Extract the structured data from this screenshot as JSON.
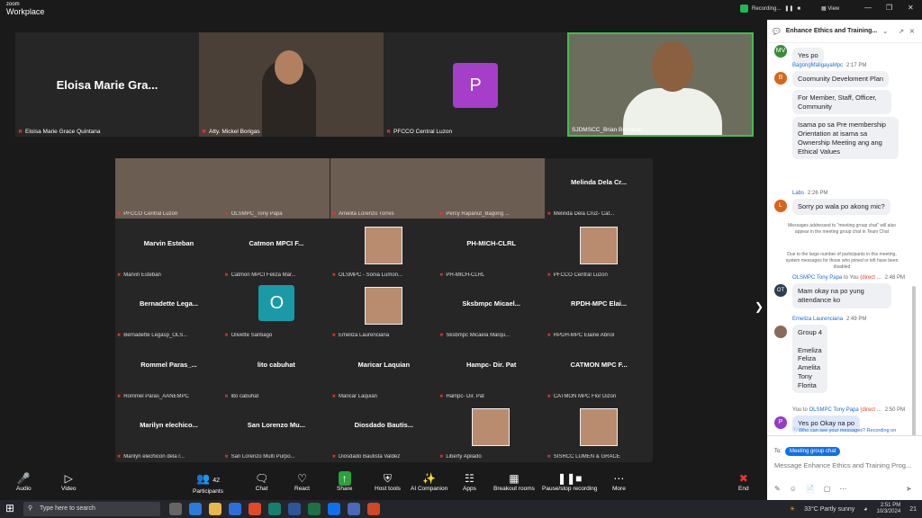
{
  "app": {
    "brand_small": "zoom",
    "brand": "Workplace",
    "recording": "Recording...",
    "view": "View",
    "win_min": "—",
    "win_max": "❐",
    "win_close": "✕"
  },
  "top_strip": [
    {
      "name": "Eloisa Marie Gra...",
      "caption": "Eloisa Marie Grace Quintana"
    },
    {
      "caption": "Atty. Mickel Borigas"
    },
    {
      "avatar": "P",
      "caption": "PFCCO Central Luzon",
      "color": "#a53ec8"
    },
    {
      "caption": "SJDMSCC_Brian Bernardo"
    }
  ],
  "gallery": [
    {
      "caption": "PFCCO Central Luzon",
      "video": true
    },
    {
      "caption": "OLSMPC_Tony Papa",
      "video": true
    },
    {
      "caption": "Amelita Lorenzo Torres",
      "video": true
    },
    {
      "caption": "Percy Rapanut_Bagong ...",
      "video": true
    },
    {
      "name": "Melinda Dela Cr...",
      "caption": "Melinda Dela Cruz- Cat..."
    },
    {
      "name": "Marvin Esteban",
      "caption": "Marvin Esteban"
    },
    {
      "name": "Catmon MPCI F...",
      "caption": "Catmon MPCI Feliza Mar..."
    },
    {
      "caption": "OLSMPC - Sonia Lumon...",
      "video": true
    },
    {
      "name": "PH-MICH-CLRL",
      "caption": "PH-MICH-CLRL"
    },
    {
      "caption": "PFCCO Central Luzon",
      "video": true
    },
    {
      "name": "Bernadette Lega...",
      "caption": "Bernadette Legasp_OLS..."
    },
    {
      "avatar": "O",
      "caption": "Olivette Santiago"
    },
    {
      "caption": "Emeliza Laurenciana",
      "video": true
    },
    {
      "name": "Sksbmpc Micael...",
      "caption": "Sksbmpc Micaela Marqu..."
    },
    {
      "name": "RPDH-MPC Elai...",
      "caption": "RPDH-MPC Elaine Abriol"
    },
    {
      "name": "Rommel Paras_...",
      "caption": "Rommel Paras_AANEMPC"
    },
    {
      "name": "lito cabuhat",
      "caption": "lito cabuhat"
    },
    {
      "name": "Maricar Laquian",
      "caption": "Maricar Laquian"
    },
    {
      "name": "Hampc- Dir. Pat",
      "caption": "Hampc- Dir. Pat"
    },
    {
      "name": "CATMON MPC F...",
      "caption": "CATMON MPC Flor Dizon"
    },
    {
      "name": "Marilyn elechico...",
      "caption": "Marilyn elechicon dela r..."
    },
    {
      "name": "San Lorenzo Mu...",
      "caption": "San Lorenzo Multi Purpo..."
    },
    {
      "name": "Diosdado Bautis...",
      "caption": "Diosdado Bautista Valdez"
    },
    {
      "caption": "Liberty Apilado",
      "video": true
    },
    {
      "caption": "SISRCC LUMEN & GRACE",
      "video": true
    }
  ],
  "chat": {
    "title": "Enhance Ethics and Training...",
    "m1_text": "Yes po",
    "m2_sender": "BagongMaligayaMpc",
    "m2_time": "2:17 PM",
    "m2_a": "Coomunity Develoment Plan",
    "m2_b": "For Member, Staff, Officer, Community",
    "m2_c": "Isama po sa Pre membership Orientation at isama sa Ownership Meeting ang ang Ethical Values",
    "m3_sender": "Labs",
    "m3_time": "2:26 PM",
    "m3_text": "Sorry po wala po akong mic?",
    "sys1": "Messages addressed to \"meeting group chat\" will also appear in the meeting group chat in Team Chat",
    "sys2": "Due to the large number of participants in this meeting, system messages for those who joined or left have been disabled",
    "m4_sender": "OLSMPC Tony Papa",
    "m4_to": "to You",
    "m4_dm": "(direct ...",
    "m4_time": "2:48 PM",
    "m4_text": "Mam okay na po yung attendance ko",
    "m5_sender": "Emeliza Laurenciana",
    "m5_time": "2:49 PM",
    "m5_text": "Group 4\n\nEmeliza\nFeliza\nAmelita\nTony\nFlorita",
    "m6_sender": "You to",
    "m6_target": "OLSMPC Tony Papa",
    "m6_dm": "(direct ...",
    "m6_time": "2:50 PM",
    "m6_text": "Yes po Okay na po",
    "who": "Who can see your messages? Recording on",
    "to_label": "To:",
    "to_value": "Meeting group chat",
    "placeholder": "Message Enhance Ethics and Training Prog..."
  },
  "toolbar": {
    "audio": "Audio",
    "video": "Video",
    "participants": "Participants",
    "participants_count": "42",
    "chat": "Chat",
    "react": "React",
    "share": "Share",
    "host_tools": "Host tools",
    "ai": "AI Companion",
    "apps": "Apps",
    "breakout": "Breakout rooms",
    "pause": "Pause/stop recording",
    "more": "More",
    "end": "End"
  },
  "taskbar": {
    "search": "Type here to search",
    "weather": "33°C  Partly sunny",
    "time": "2:51 PM",
    "date": "10/3/2024",
    "notif": "21"
  }
}
